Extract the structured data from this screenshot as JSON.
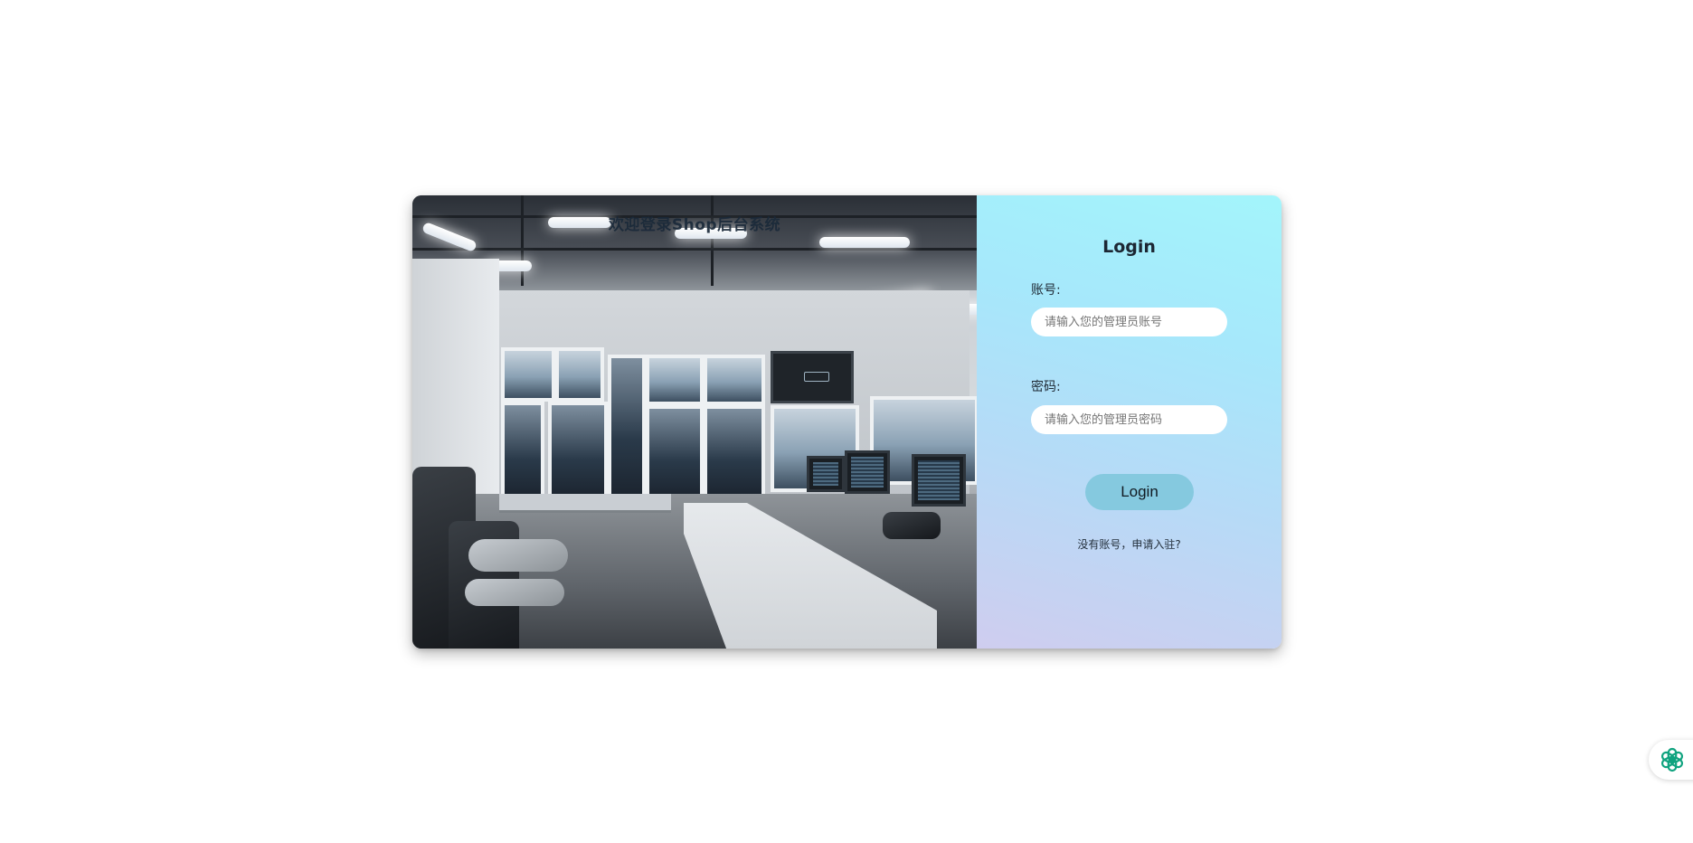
{
  "banner": {
    "title": "欢迎登录Shop后台系统"
  },
  "login": {
    "title": "Login",
    "account_label": "账号:",
    "account_placeholder": "请输入您的管理员账号",
    "password_label": "密码:",
    "password_placeholder": "请输入您的管理员密码",
    "submit_label": "Login",
    "register_link": "没有账号，申请入驻?"
  },
  "widget": {
    "icon": "openai-logo-icon",
    "color": "#10a37f"
  },
  "colors": {
    "panel_gradient_top": "#a3f5fb",
    "panel_gradient_bottom": "#cfcdef",
    "button": "#85c9df"
  }
}
